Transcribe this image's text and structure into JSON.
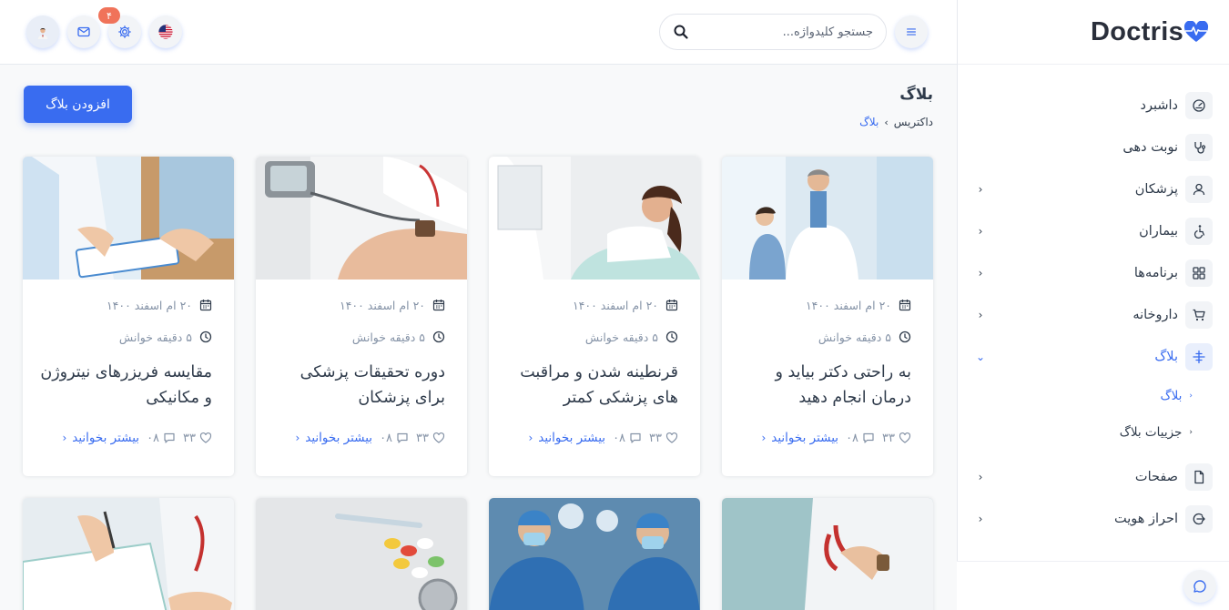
{
  "brand": {
    "name": "Doctris"
  },
  "search": {
    "placeholder": "جستجو کلیدواژه..."
  },
  "notifications": {
    "badge": "۴"
  },
  "page": {
    "title": "بلاگ",
    "breadcrumb": {
      "home": "داکتریس",
      "current": "بلاگ"
    },
    "add_button": "افزودن بلاگ"
  },
  "sidebar": {
    "items": [
      {
        "label": "داشبرد",
        "icon": "dashboard-icon"
      },
      {
        "label": "نوبت دهی",
        "icon": "stethoscope-icon"
      },
      {
        "label": "پزشکان",
        "icon": "user-icon"
      },
      {
        "label": "بیماران",
        "icon": "wheelchair-icon"
      },
      {
        "label": "برنامه‌ها",
        "icon": "apps-grid-icon"
      },
      {
        "label": "داروخانه",
        "icon": "cart-icon"
      },
      {
        "label": "بلاگ",
        "icon": "blog-icon"
      },
      {
        "label": "صفحات",
        "icon": "file-icon"
      },
      {
        "label": "احراز هویت",
        "icon": "login-icon"
      }
    ],
    "blog_submenu": [
      {
        "label": "بلاگ"
      },
      {
        "label": "جزییات بلاگ"
      }
    ]
  },
  "posts": [
    {
      "date": "۲۰ ام اسفند ۱۴۰۰",
      "read_time": "۵ دقیقه خوانش",
      "title": "به راحتی دکتر بیاید و درمان انجام دهید",
      "likes": "۳۳",
      "comments": "۰۸",
      "more": "بیشتر بخوانید"
    },
    {
      "date": "۲۰ ام اسفند ۱۴۰۰",
      "read_time": "۵ دقیقه خوانش",
      "title": "قرنطینه شدن و مراقبت های پزشکی کمتر",
      "likes": "۳۳",
      "comments": "۰۸",
      "more": "بیشتر بخوانید"
    },
    {
      "date": "۲۰ ام اسفند ۱۴۰۰",
      "read_time": "۵ دقیقه خوانش",
      "title": "دوره تحقیقات پزشکی برای پزشکان",
      "likes": "۳۳",
      "comments": "۰۸",
      "more": "بیشتر بخوانید"
    },
    {
      "date": "۲۰ ام اسفند ۱۴۰۰",
      "read_time": "۵ دقیقه خوانش",
      "title": "مقایسه فریزرهای نیتروژن و مکانیکی",
      "likes": "۳۳",
      "comments": "۰۸",
      "more": "بیشتر بخوانید"
    }
  ],
  "colors": {
    "accent": "#396cf0",
    "badge": "#f0735a",
    "muted": "#8492a6",
    "text": "#2f3b4b"
  }
}
